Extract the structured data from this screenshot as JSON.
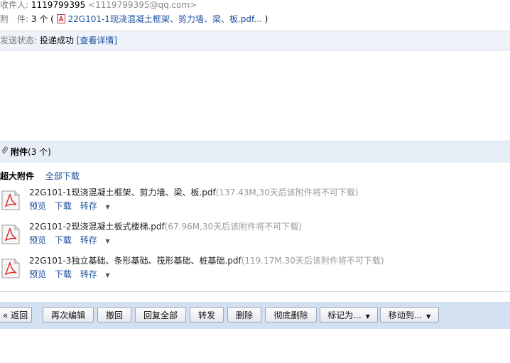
{
  "header": {
    "recipient_label": "收件人:",
    "recipient_name": "1119799395",
    "recipient_email": "<1119799395@qq.com>",
    "attach_label": "附　件:",
    "attach_count": "3 个",
    "attach_open_paren": "(",
    "attach_first": "22G101-1现浇混凝土框架、剪力墙、梁、板.pdf...",
    "attach_close_paren": ")"
  },
  "status": {
    "label": "发送状态:",
    "value": "投递成功",
    "details_link": "[查看详情]"
  },
  "attachments": {
    "title": "附件",
    "count": "(3 个)",
    "super_title": "超大附件",
    "download_all": "全部下载",
    "files": [
      {
        "name": "22G101-1现浇混凝土框架、剪力墙、梁、板.pdf",
        "size": "(137.43M,30天后该附件将不可下载)"
      },
      {
        "name": "22G101-2现浇混凝土板式楼梯.pdf",
        "size": "(67.96M,30天后该附件将不可下载)"
      },
      {
        "name": "22G101-3独立基础、条形基础、筏形基础、桩基础.pdf",
        "size": "(119.17M,30天后该附件将不可下载)"
      }
    ],
    "actions": {
      "preview": "预览",
      "download": "下载",
      "save": "转存"
    }
  },
  "toolbar": {
    "back": "« 返回",
    "edit_again": "再次编辑",
    "recall": "撤回",
    "reply_all": "回复全部",
    "forward": "转发",
    "delete": "删除",
    "delete_perm": "彻底删除",
    "mark_as": "标记为...",
    "move_to": "移动到..."
  }
}
